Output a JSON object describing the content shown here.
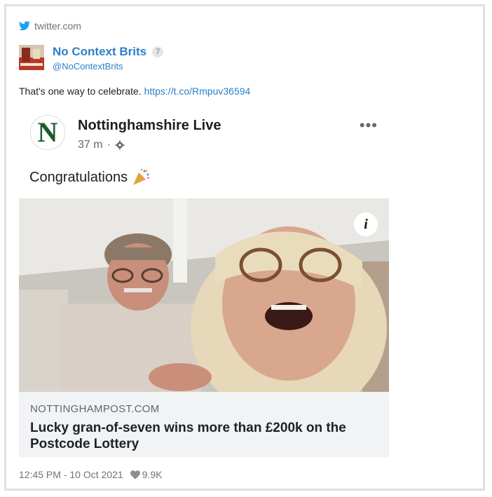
{
  "tweet": {
    "source": "twitter.com",
    "source_icon": "twitter-bird-icon",
    "author_name": "No Context Brits",
    "author_badge": "7",
    "author_handle": "@NoContextBrits",
    "text": "That's one way to celebrate.",
    "link": "https://t.co/Rmpuv36594",
    "timestamp": "12:45 PM - 10 Oct 2021",
    "likes": "9.9K"
  },
  "embed": {
    "page_logo": "N",
    "page_name": "Nottinghamshire Live",
    "post_time": "37 m",
    "separator": "·",
    "more_label": "•••",
    "post_text": "Congratulations",
    "link_domain": "NOTTINGHAMPOST.COM",
    "link_title": "Lucky gran-of-seven wins more than £200k on the Postcode Lottery",
    "info_label": "i"
  },
  "colors": {
    "link": "#2a80c8",
    "text": "#1c2022",
    "muted": "#6e7378",
    "logo_green": "#1d5a2a"
  }
}
